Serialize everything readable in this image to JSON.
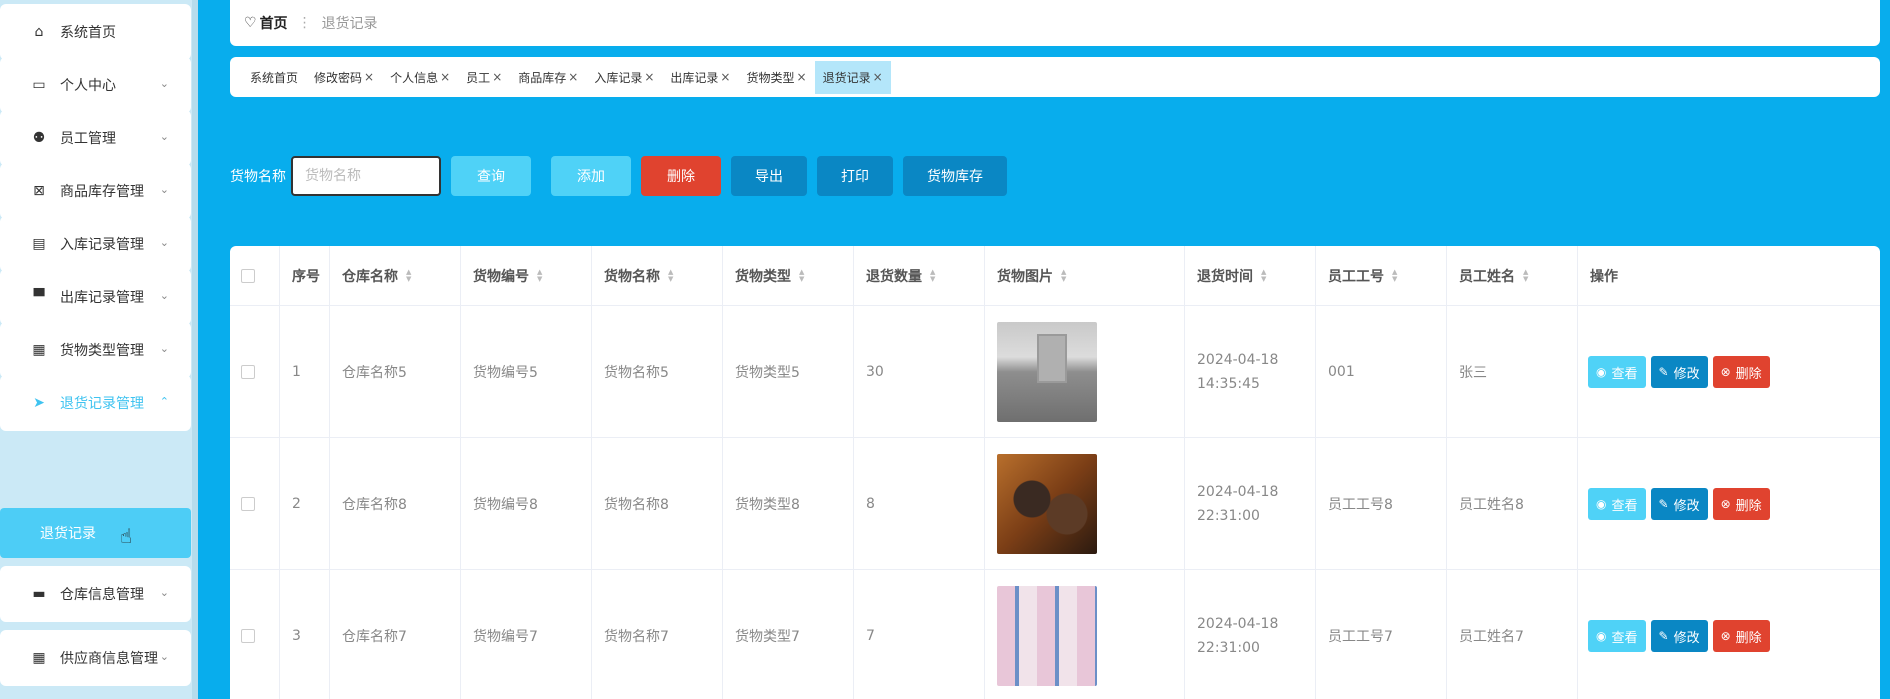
{
  "sidebar": {
    "items": [
      {
        "label": "系统首页",
        "icon": "home-icon",
        "glyph": "⌂",
        "chevron": ""
      },
      {
        "label": "个人中心",
        "icon": "card-icon",
        "glyph": "▭",
        "chevron": "⌄"
      },
      {
        "label": "员工管理",
        "icon": "user-icon",
        "glyph": "👤",
        "chevron": "⌄"
      },
      {
        "label": "商品库存管理",
        "icon": "clipboard-x-icon",
        "glyph": "⊠",
        "chevron": "⌄"
      },
      {
        "label": "入库记录管理",
        "icon": "clipboard-icon",
        "glyph": "📋",
        "chevron": "⌄"
      },
      {
        "label": "出库记录管理",
        "icon": "brush-icon",
        "glyph": "▀",
        "chevron": "⌄"
      },
      {
        "label": "货物类型管理",
        "icon": "grid-icon",
        "glyph": "▦",
        "chevron": "⌄"
      },
      {
        "label": "退货记录管理",
        "icon": "send-icon",
        "glyph": "➤",
        "chevron": "⌃"
      },
      {
        "label": "仓库信息管理",
        "icon": "message-icon",
        "glyph": "▬",
        "chevron": "⌄"
      },
      {
        "label": "供应商信息管理",
        "icon": "grid-icon",
        "glyph": "▦",
        "chevron": "⌄"
      }
    ],
    "submenu_label": "退货记录"
  },
  "breadcrumb": {
    "home": "首页",
    "current": "退货记录"
  },
  "tags": [
    "系统首页",
    "修改密码",
    "个人信息",
    "员工",
    "商品库存",
    "入库记录",
    "出库记录",
    "货物类型",
    "退货记录"
  ],
  "search": {
    "label": "货物名称",
    "placeholder": "货物名称",
    "value": ""
  },
  "buttons": {
    "query": "查询",
    "add": "添加",
    "delete": "删除",
    "export": "导出",
    "print": "打印",
    "stock": "货物库存"
  },
  "table": {
    "headers": [
      "序号",
      "仓库名称",
      "货物编号",
      "货物名称",
      "货物类型",
      "退货数量",
      "货物图片",
      "退货时间",
      "员工工号",
      "员工姓名",
      "操作"
    ],
    "rows": [
      {
        "index": "1",
        "warehouse": "仓库名称5",
        "code": "货物编号5",
        "name": "货物名称5",
        "type": "货物类型5",
        "qty": "30",
        "image": "warehouse",
        "time": "2024-04-18 14:35:45",
        "emp_no": "001",
        "emp_name": "张三"
      },
      {
        "index": "2",
        "warehouse": "仓库名称8",
        "code": "货物编号8",
        "name": "货物名称8",
        "type": "货物类型8",
        "qty": "8",
        "image": "mooncake",
        "time": "2024-04-18 22:31:00",
        "emp_no": "员工工号8",
        "emp_name": "员工姓名8"
      },
      {
        "index": "3",
        "warehouse": "仓库名称7",
        "code": "货物编号7",
        "name": "货物名称7",
        "type": "货物类型7",
        "qty": "7",
        "image": "boxes",
        "time": "2024-04-18 22:31:00",
        "emp_no": "员工工号7",
        "emp_name": "员工姓名7"
      }
    ],
    "actions": {
      "view": "查看",
      "edit": "修改",
      "delete": "删除"
    }
  },
  "colors": {
    "background": "#08aded",
    "accent": "#4fd2f7",
    "danger": "#e0432f",
    "primary": "#0a87c4"
  }
}
